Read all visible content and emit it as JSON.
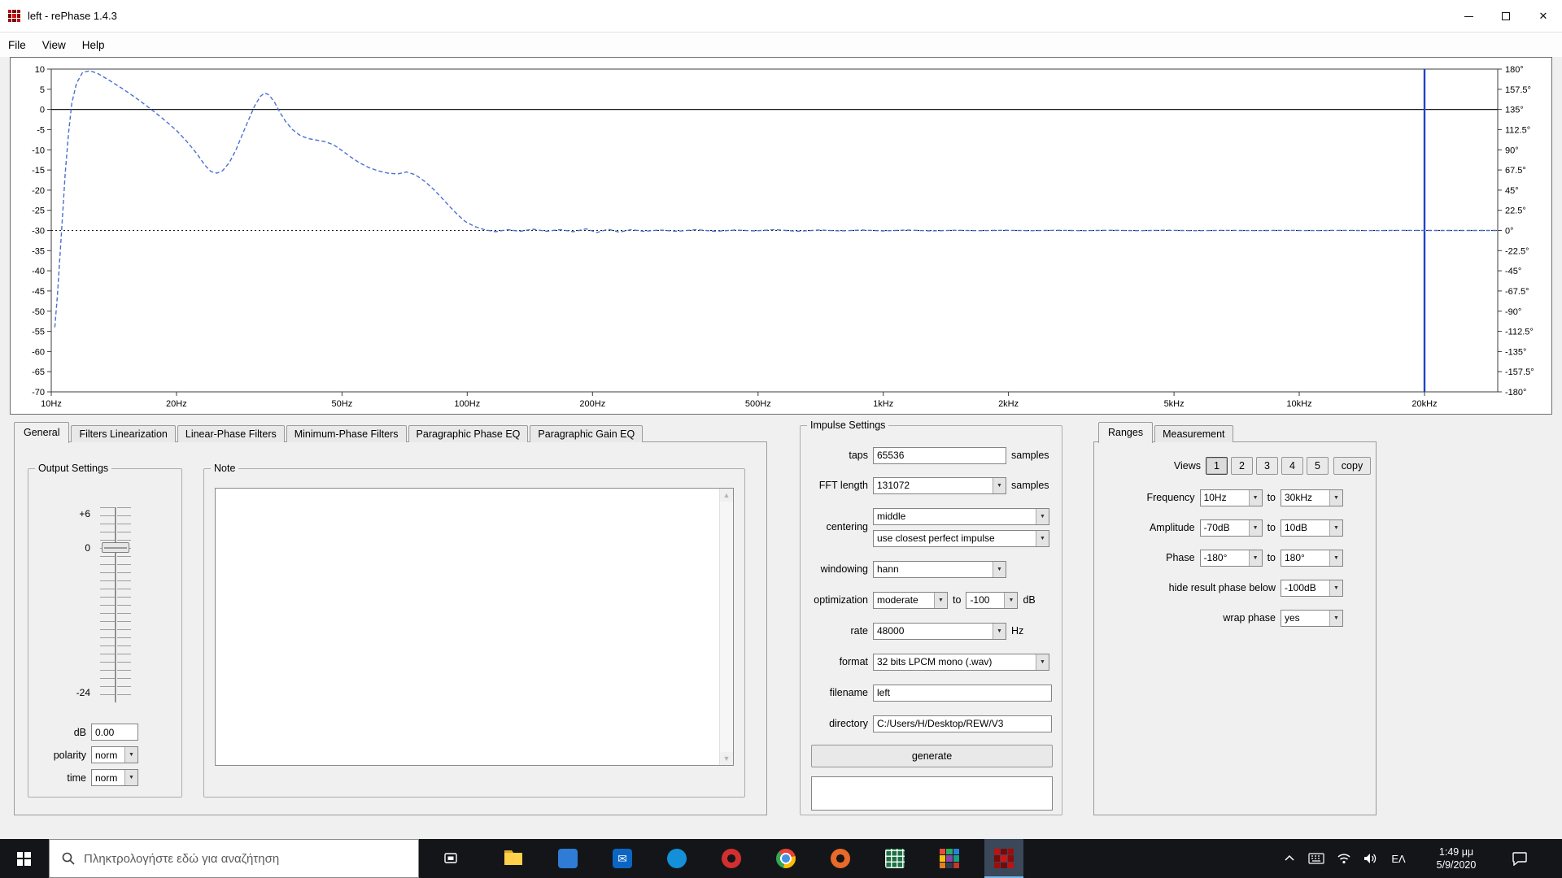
{
  "window": {
    "title": "left  -  rePhase 1.4.3",
    "menus": [
      "File",
      "View",
      "Help"
    ]
  },
  "icons": {
    "combo_arrow": "▼",
    "scroll_up": "▲",
    "scroll_down": "▼",
    "close_glyph": "✕",
    "rephase_grid_colors": [
      "#c01010",
      "#7a0808",
      "#a00c0c",
      "#7a0808",
      "#d01414",
      "#8c0a0a",
      "#a00c0c",
      "#7a0808",
      "#c01010"
    ],
    "rew_grid_colors": [
      "#e74c3c",
      "#27ae60",
      "#2980d9",
      "#f1c40f",
      "#8e44ad",
      "#16a085",
      "#e67e22",
      "#2c3e50",
      "#c0392b"
    ]
  },
  "chart_data": {
    "type": "line",
    "x_scale": "log",
    "x_range_hz": [
      10,
      30000
    ],
    "amplitude_range_db": [
      -70,
      10
    ],
    "phase_range_deg": [
      -180,
      180
    ],
    "x_ticks": [
      {
        "hz": 10,
        "label": "10Hz"
      },
      {
        "hz": 20,
        "label": "20Hz"
      },
      {
        "hz": 50,
        "label": "50Hz"
      },
      {
        "hz": 100,
        "label": "100Hz"
      },
      {
        "hz": 200,
        "label": "200Hz"
      },
      {
        "hz": 500,
        "label": "500Hz"
      },
      {
        "hz": 1000,
        "label": "1kHz"
      },
      {
        "hz": 2000,
        "label": "2kHz"
      },
      {
        "hz": 5000,
        "label": "5kHz"
      },
      {
        "hz": 10000,
        "label": "10kHz"
      },
      {
        "hz": 20000,
        "label": "20kHz"
      }
    ],
    "amplitude_ticks": [
      10,
      5,
      0,
      -5,
      -10,
      -15,
      -20,
      -25,
      -30,
      -35,
      -40,
      -45,
      -50,
      -55,
      -60,
      -65,
      -70
    ],
    "phase_tick_labels": [
      "180°",
      "157.5°",
      "135°",
      "112.5°",
      "90°",
      "67.5°",
      "45°",
      "22.5°",
      "0°",
      "-22.5°",
      "-45°",
      "-67.5°",
      "-90°",
      "-112.5°",
      "-135°",
      "-157.5°",
      "-180°"
    ],
    "reference_lines": {
      "solid_at_db": 0,
      "dotted_at_phase_deg": 0
    },
    "marker_line": {
      "hz": 20000,
      "color": "#2144c8"
    },
    "series": [
      {
        "name": "measurement",
        "color": "#4a6fd0",
        "dash": "5 3",
        "points": [
          [
            10.2,
            -54
          ],
          [
            10.35,
            -46
          ],
          [
            10.5,
            -36
          ],
          [
            10.65,
            -26
          ],
          [
            10.8,
            -16
          ],
          [
            11.0,
            -6
          ],
          [
            11.2,
            1.5
          ],
          [
            11.5,
            6.5
          ],
          [
            11.9,
            9.2
          ],
          [
            12.4,
            9.6
          ],
          [
            13.0,
            8.8
          ],
          [
            13.8,
            7.2
          ],
          [
            14.8,
            5.2
          ],
          [
            15.8,
            3.2
          ],
          [
            16.8,
            1.2
          ],
          [
            17.8,
            -0.8
          ],
          [
            18.8,
            -2.8
          ],
          [
            20.0,
            -5.2
          ],
          [
            21.2,
            -8.0
          ],
          [
            22.4,
            -11.0
          ],
          [
            23.4,
            -13.8
          ],
          [
            24.2,
            -15.4
          ],
          [
            25.0,
            -15.8
          ],
          [
            25.8,
            -15.2
          ],
          [
            26.8,
            -13.2
          ],
          [
            27.8,
            -10.0
          ],
          [
            28.8,
            -6.2
          ],
          [
            29.8,
            -2.6
          ],
          [
            30.8,
            0.8
          ],
          [
            31.8,
            3.2
          ],
          [
            32.6,
            4.1
          ],
          [
            33.4,
            3.6
          ],
          [
            34.4,
            1.8
          ],
          [
            35.4,
            -0.6
          ],
          [
            36.6,
            -3.0
          ],
          [
            38.0,
            -5.0
          ],
          [
            39.6,
            -6.4
          ],
          [
            41.4,
            -7.2
          ],
          [
            43.4,
            -7.6
          ],
          [
            45.6,
            -8.0
          ],
          [
            47.8,
            -8.8
          ],
          [
            50.0,
            -10.2
          ],
          [
            52.5,
            -11.8
          ],
          [
            55.0,
            -13.2
          ],
          [
            58.0,
            -14.4
          ],
          [
            61.0,
            -15.2
          ],
          [
            64.5,
            -15.8
          ],
          [
            68.0,
            -16.0
          ],
          [
            71.5,
            -15.5
          ],
          [
            75.0,
            -16.2
          ],
          [
            79.0,
            -17.8
          ],
          [
            83.0,
            -19.8
          ],
          [
            87.0,
            -22.0
          ],
          [
            91.0,
            -24.2
          ],
          [
            95.0,
            -26.2
          ],
          [
            99.0,
            -27.8
          ],
          [
            104.0,
            -29.0
          ],
          [
            110.0,
            -29.8
          ],
          [
            117.0,
            -30.3
          ],
          [
            125.0,
            -29.8
          ],
          [
            134.0,
            -30.2
          ],
          [
            144.0,
            -29.7
          ],
          [
            155.0,
            -30.2
          ],
          [
            167.0,
            -29.8
          ],
          [
            180.0,
            -30.3
          ],
          [
            193.0,
            -29.6
          ],
          [
            205.0,
            -30.5
          ],
          [
            218.0,
            -29.7
          ],
          [
            232.0,
            -30.4
          ],
          [
            248.0,
            -29.8
          ],
          [
            266.0,
            -30.2
          ],
          [
            290.0,
            -29.9
          ],
          [
            320.0,
            -30.2
          ],
          [
            355.0,
            -29.8
          ],
          [
            395.0,
            -30.2
          ],
          [
            440.0,
            -29.9
          ],
          [
            490.0,
            -30.1
          ],
          [
            550.0,
            -29.8
          ],
          [
            620.0,
            -30.2
          ],
          [
            700.0,
            -29.9
          ],
          [
            790.0,
            -30.1
          ],
          [
            890.0,
            -29.9
          ],
          [
            1000.0,
            -30.1
          ],
          [
            1140.0,
            -29.9
          ],
          [
            1300.0,
            -30.1
          ],
          [
            1490.0,
            -29.95
          ],
          [
            1700.0,
            -30.05
          ],
          [
            1950.0,
            -29.95
          ],
          [
            2250.0,
            -30.05
          ],
          [
            2600.0,
            -29.95
          ],
          [
            3000.0,
            -30.05
          ],
          [
            3500.0,
            -29.96
          ],
          [
            4100.0,
            -30.04
          ],
          [
            4800.0,
            -29.96
          ],
          [
            5600.0,
            -30.04
          ],
          [
            6600.0,
            -29.97
          ],
          [
            7800.0,
            -30.03
          ],
          [
            9200.0,
            -29.97
          ],
          [
            10800.0,
            -30.03
          ],
          [
            12700.0,
            -29.98
          ],
          [
            15000.0,
            -30.02
          ],
          [
            17600.0,
            -29.98
          ],
          [
            20000.0,
            -30.0
          ],
          [
            23500.0,
            -30.0
          ],
          [
            28000.0,
            -30.0
          ],
          [
            29800.0,
            -30.0
          ]
        ]
      }
    ]
  },
  "tabs": {
    "items": [
      "General",
      "Filters Linearization",
      "Linear-Phase Filters",
      "Minimum-Phase Filters",
      "Paragraphic Phase EQ",
      "Paragraphic Gain EQ"
    ],
    "selected": "General"
  },
  "output_settings": {
    "title": "Output Settings",
    "gain_labels": [
      "+6",
      "0",
      "-24"
    ],
    "db_label": "dB",
    "db_value": "0.00",
    "polarity_label": "polarity",
    "polarity_value": "norm",
    "time_label": "time",
    "time_value": "norm"
  },
  "note": {
    "title": "Note",
    "text": ""
  },
  "impulse_settings": {
    "title": "Impulse Settings",
    "taps_label": "taps",
    "taps_value": "65536",
    "taps_unit": "samples",
    "fft_label": "FFT length",
    "fft_value": "131072",
    "fft_unit": "samples",
    "centering_label": "centering",
    "centering_value": "middle",
    "centering_mode_value": "use closest perfect impulse",
    "windowing_label": "windowing",
    "windowing_value": "hann",
    "optimization_label": "optimization",
    "optimization_value": "moderate",
    "optimization_to": "to",
    "optimization_db_value": "-100",
    "optimization_unit": "dB",
    "rate_label": "rate",
    "rate_value": "48000",
    "rate_unit": "Hz",
    "format_label": "format",
    "format_value": "32 bits LPCM mono (.wav)",
    "filename_label": "filename",
    "filename_value": "left",
    "directory_label": "directory",
    "directory_value": "C:/Users/H/Desktop/REW/V3",
    "generate_label": "generate",
    "status_value": ""
  },
  "ranges": {
    "tabs": {
      "items": [
        "Ranges",
        "Measurement"
      ],
      "selected": "Ranges"
    },
    "views_label": "Views",
    "view_buttons": [
      "1",
      "2",
      "3",
      "4",
      "5"
    ],
    "copy_label": "copy",
    "to_label": "to",
    "frequency_label": "Frequency",
    "frequency_from": "10Hz",
    "frequency_to": "30kHz",
    "amplitude_label": "Amplitude",
    "amplitude_from": "-70dB",
    "amplitude_to": "10dB",
    "phase_label": "Phase",
    "phase_from": "-180°",
    "phase_to": "180°",
    "hide_label": "hide result phase below",
    "hide_value": "-100dB",
    "wrap_label": "wrap phase",
    "wrap_value": "yes"
  },
  "taskbar": {
    "search_placeholder": "Πληκτρολογήστε εδώ για αναζήτηση",
    "language_indicator": "ΕΛ",
    "clock": {
      "time": "1:49 μμ",
      "date": "5/9/2020"
    },
    "apps": [
      {
        "name": "file-explorer",
        "kind": "folder",
        "color": "#ffd04a"
      },
      {
        "name": "photos",
        "kind": "square",
        "color": "#2f7cd6"
      },
      {
        "name": "mail",
        "kind": "mail",
        "color": "#0b66c3"
      },
      {
        "name": "edge",
        "kind": "circle",
        "color": "#1390d8"
      },
      {
        "name": "opera",
        "kind": "ring",
        "color": "#d1302f"
      },
      {
        "name": "chrome",
        "kind": "chrome",
        "color": "#4a90e2"
      },
      {
        "name": "firefox",
        "kind": "ring",
        "color": "#e8692a"
      },
      {
        "name": "excel",
        "kind": "square-grid",
        "color": "#1e7145"
      },
      {
        "name": "rew",
        "kind": "grid-multicolor",
        "color": ""
      },
      {
        "name": "rephase",
        "kind": "grid-red",
        "color": "#b00000",
        "active": true
      }
    ]
  }
}
